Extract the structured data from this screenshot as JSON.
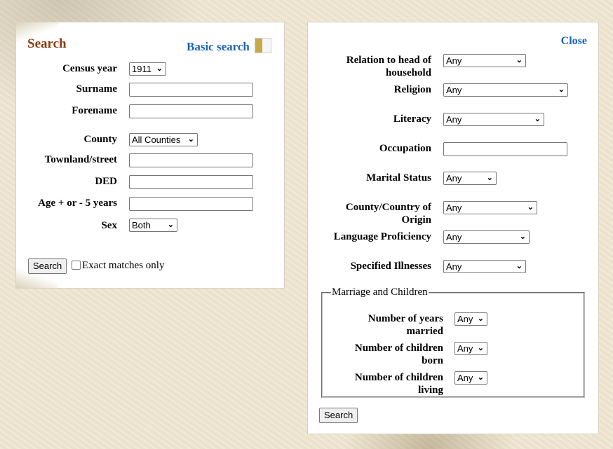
{
  "left_panel": {
    "title": "Search",
    "basic_search_link": "Basic search",
    "fields": {
      "census_year": {
        "label": "Census year",
        "value": "1911"
      },
      "surname": {
        "label": "Surname",
        "value": ""
      },
      "forename": {
        "label": "Forename",
        "value": ""
      },
      "county": {
        "label": "County",
        "value": "All Counties"
      },
      "townland": {
        "label": "Townland/street",
        "value": ""
      },
      "ded": {
        "label": "DED",
        "value": ""
      },
      "age": {
        "label": "Age + or - 5 years",
        "value": ""
      },
      "sex": {
        "label": "Sex",
        "value": "Both"
      }
    },
    "search_button": "Search",
    "exact_matches_label": "Exact matches only",
    "exact_matches_checked": false
  },
  "right_panel": {
    "close_link": "Close",
    "fields": {
      "relation_l1": "Relation to head of",
      "relation_l2": "household",
      "relation_value": "Any",
      "religion_label": "Religion",
      "religion_value": "Any",
      "literacy_label": "Literacy",
      "literacy_value": "Any",
      "occupation_label": "Occupation",
      "occupation_value": "",
      "marital_label": "Marital Status",
      "marital_value": "Any",
      "origin_l1": "County/Country of",
      "origin_l2": "Origin",
      "origin_value": "Any",
      "language_label": "Language Proficiency",
      "language_value": "Any",
      "illness_label": "Specified Illnesses",
      "illness_value": "Any"
    },
    "marriage_children": {
      "legend": "Marriage and Children",
      "years_married_l1": "Number of years",
      "years_married_l2": "married",
      "years_married_value": "Any",
      "children_born_l1": "Number of children",
      "children_born_l2": "born",
      "children_born_value": "Any",
      "children_living_l1": "Number of children",
      "children_living_l2": "living",
      "children_living_value": "Any"
    },
    "search_button": "Search"
  },
  "icons": {
    "chevron": "⌄"
  }
}
